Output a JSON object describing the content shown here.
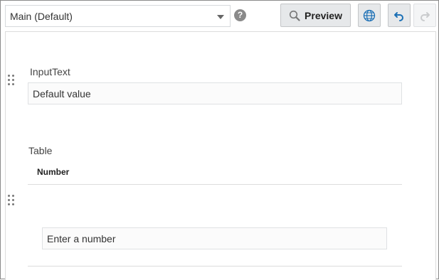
{
  "toolbar": {
    "layout_select_value": "Main (Default)",
    "help_glyph": "?",
    "preview_label": "Preview",
    "icons": [
      "chevron-down-icon",
      "help-icon",
      "search-icon",
      "globe-icon",
      "undo-icon",
      "redo-icon"
    ],
    "accent_color": "#1a6fb5"
  },
  "canvas": {
    "input_text": {
      "label": "InputText",
      "value": "Default value"
    },
    "table": {
      "label": "Table",
      "columns": [
        "Number"
      ],
      "row_input_placeholder": "Enter a number"
    }
  }
}
